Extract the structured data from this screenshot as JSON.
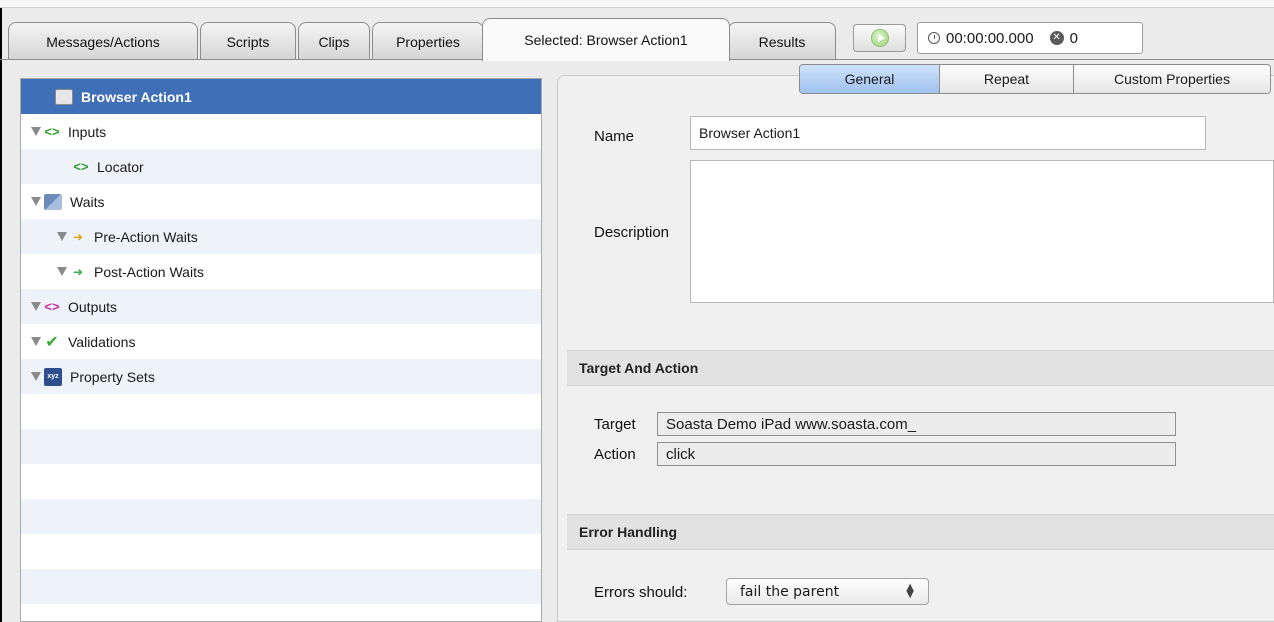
{
  "tabs": [
    {
      "label": "Messages/Actions"
    },
    {
      "label": "Scripts"
    },
    {
      "label": "Clips"
    },
    {
      "label": "Properties"
    },
    {
      "label": "Selected: Browser Action1"
    },
    {
      "label": "Results"
    }
  ],
  "active_tab": "Selected: Browser Action1",
  "timer": {
    "elapsed": "00:00:00.000",
    "error_count": "0"
  },
  "tree": {
    "items": [
      {
        "label": "Browser Action1",
        "icon": "browser-action-icon",
        "selected": true
      },
      {
        "label": "Inputs",
        "icon": "code-brackets-icon"
      },
      {
        "label": "Locator",
        "icon": "code-brackets-icon"
      },
      {
        "label": "Waits",
        "icon": "hourglass-icon"
      },
      {
        "label": "Pre-Action Waits",
        "icon": "pre-wait-icon"
      },
      {
        "label": "Post-Action Waits",
        "icon": "post-wait-icon"
      },
      {
        "label": "Outputs",
        "icon": "code-brackets-icon"
      },
      {
        "label": "Validations",
        "icon": "checkmark-icon"
      },
      {
        "label": "Property Sets",
        "icon": "xyz-property-icon"
      }
    ]
  },
  "subtabs": [
    {
      "label": "General",
      "active": true
    },
    {
      "label": "Repeat"
    },
    {
      "label": "Custom Properties"
    }
  ],
  "general": {
    "name_label": "Name",
    "name_value": "Browser Action1",
    "description_label": "Description",
    "description_value": ""
  },
  "target_section": {
    "title": "Target And Action",
    "target_label": "Target",
    "target_value": "Soasta Demo iPad www.soasta.com_",
    "action_label": "Action",
    "action_value": "click"
  },
  "error_section": {
    "title": "Error Handling",
    "errors_label": "Errors should:",
    "errors_value": "fail the parent"
  },
  "colors": {
    "selection": "#3f6fb6",
    "alt_row": "#eef3fa",
    "active_subtab": "#9fc2ef"
  }
}
